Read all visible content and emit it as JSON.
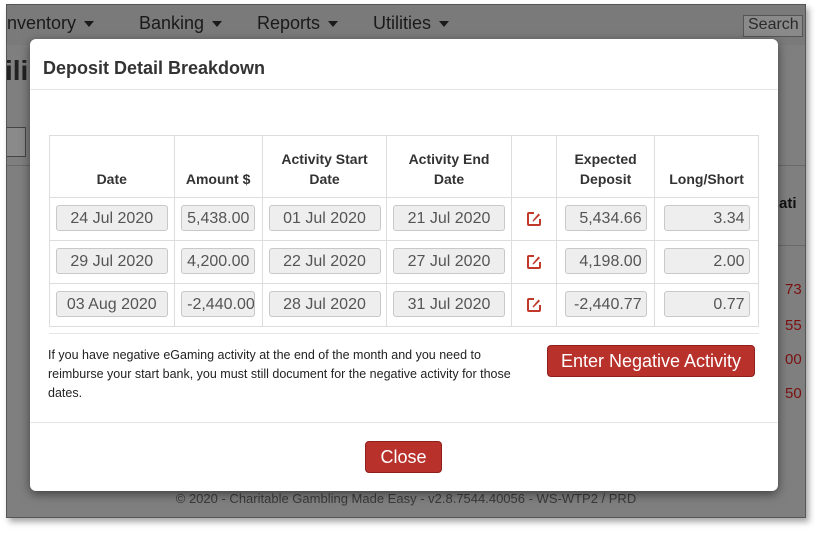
{
  "background": {
    "nav": [
      "nventory",
      "Banking",
      "Reports",
      "Utilities"
    ],
    "search_placeholder": "Search",
    "page_title_fragment": "ili",
    "table_header_fragment": "ati",
    "row_numbers": [
      "73",
      "55",
      "00",
      "50"
    ],
    "footer": "© 2020 - Charitable Gambling Made Easy - v2.8.7544.40056 - WS-WTP2 / PRD"
  },
  "modal": {
    "title": "Deposit Detail Breakdown",
    "columns": {
      "date": "Date",
      "amount": "Amount $",
      "start1": "Activity Start",
      "start2": "Date",
      "end1": "Activity End",
      "end2": "Date",
      "exp1": "Expected",
      "exp2": "Deposit",
      "ls": "Long/Short"
    },
    "rows": [
      {
        "date": "24 Jul 2020",
        "amount": "5,438.00",
        "start": "01 Jul 2020",
        "end": "21 Jul 2020",
        "expected": "5,434.66",
        "long_short": "3.34"
      },
      {
        "date": "29 Jul 2020",
        "amount": "4,200.00",
        "start": "22 Jul 2020",
        "end": "27 Jul 2020",
        "expected": "4,198.00",
        "long_short": "2.00"
      },
      {
        "date": "03 Aug 2020",
        "amount": "-2,440.00",
        "start": "28 Jul 2020",
        "end": "31 Jul 2020",
        "expected": "-2,440.77",
        "long_short": "0.77"
      }
    ],
    "note": "If you have negative eGaming activity at the end of the month and you need to reimburse your start bank, you must still document for the negative activity for those dates.",
    "negative_button": "Enter Negative Activity",
    "close_button": "Close"
  },
  "colors": {
    "accent": "#b8312b",
    "edit_icon": "#c0392b"
  },
  "icons": {
    "edit": "edit-icon"
  }
}
